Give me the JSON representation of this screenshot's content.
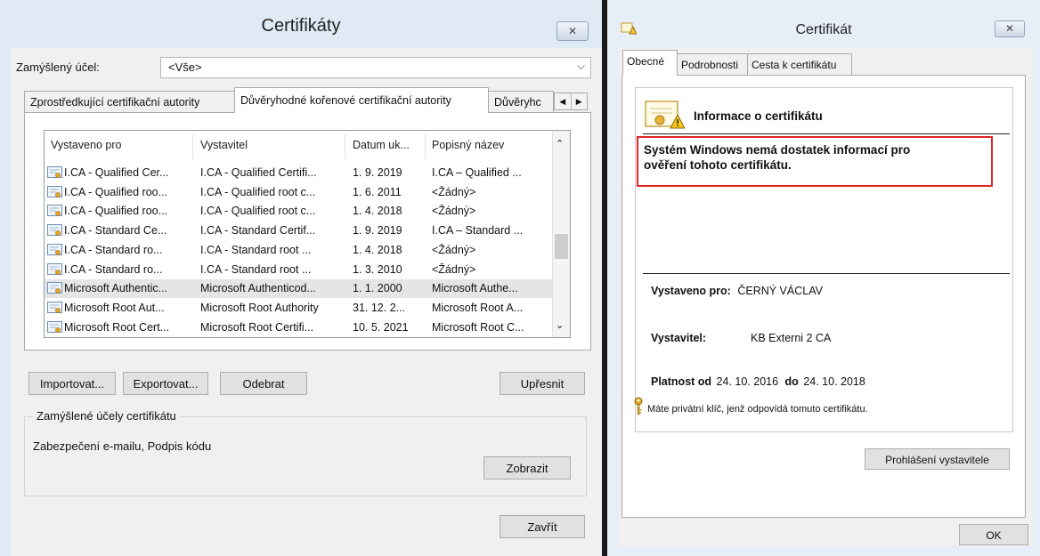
{
  "left_window": {
    "title": "Certifikáty",
    "close_glyph": "✕",
    "purpose_label": "Zamýšlený účel:",
    "purpose_value": "<Vše>",
    "tabs": [
      "Zprostředkující certifikační autority",
      "Důvěryhodné kořenové certifikační autority",
      "Důvěryhc"
    ],
    "columns": [
      "Vystaveno pro",
      "Vystavitel",
      "Datum uk...",
      "Popisný název"
    ],
    "rows": [
      {
        "issued_to": "I.CA - Qualified Cer...",
        "issuer": "I.CA - Qualified Certifi...",
        "date": "1. 9. 2019",
        "name": "I.CA – Qualified ..."
      },
      {
        "issued_to": "I.CA - Qualified roo...",
        "issuer": "I.CA - Qualified root c...",
        "date": "1. 6. 2011",
        "name": "<Žádný>"
      },
      {
        "issued_to": "I.CA - Qualified roo...",
        "issuer": "I.CA - Qualified root c...",
        "date": "1. 4. 2018",
        "name": "<Žádný>"
      },
      {
        "issued_to": "I.CA - Standard Ce...",
        "issuer": "I.CA - Standard Certif...",
        "date": "1. 9. 2019",
        "name": "I.CA – Standard ..."
      },
      {
        "issued_to": "I.CA - Standard ro...",
        "issuer": "I.CA - Standard root ...",
        "date": "1. 4. 2018",
        "name": "<Žádný>"
      },
      {
        "issued_to": "I.CA - Standard ro...",
        "issuer": "I.CA - Standard root ...",
        "date": "1. 3. 2010",
        "name": "<Žádný>"
      },
      {
        "issued_to": "Microsoft Authentic...",
        "issuer": "Microsoft Authenticod...",
        "date": "1. 1. 2000",
        "name": "Microsoft Authe..."
      },
      {
        "issued_to": "Microsoft Root Aut...",
        "issuer": "Microsoft Root Authority",
        "date": "31. 12. 2...",
        "name": "Microsoft Root A..."
      },
      {
        "issued_to": "Microsoft Root Cert...",
        "issuer": "Microsoft Root Certifi...",
        "date": "10. 5. 2021",
        "name": "Microsoft Root C..."
      }
    ],
    "buttons": {
      "import": "Importovat...",
      "export": "Exportovat...",
      "remove": "Odebrat",
      "advanced": "Upřesnit",
      "view": "Zobrazit",
      "close": "Zavřít"
    },
    "purposes_group_label": "Zamýšlené účely certifikátu",
    "purposes_value": "Zabezpečení e-mailu, Podpis kódu"
  },
  "right_window": {
    "title": "Certifikát",
    "close_glyph": "✕",
    "tabs": [
      "Obecné",
      "Podrobnosti",
      "Cesta k certifikátu"
    ],
    "info_title": "Informace o certifikátu",
    "warning_line1": "Systém Windows nemá dostatek informací pro",
    "warning_line2": "ověření tohoto certifikátu.",
    "issued_to_label": "Vystaveno pro:",
    "issued_to_value": "ČERNÝ VÁCLAV",
    "issuer_label": "Vystavitel:",
    "issuer_value": "KB Externi 2 CA",
    "valid_from_label": "Platnost od",
    "valid_from_value": "24. 10. 2016",
    "valid_to_label": "do",
    "valid_to_value": "24. 10. 2018",
    "private_key_note": "Máte privátní klíč, jenž odpovídá tomuto certifikátu.",
    "issuer_statement_button": "Prohlášení vystavitele",
    "ok_button": "OK"
  },
  "colors": {
    "highlight_border": "#e0252a",
    "window_frame": "#dfeaf5",
    "dialog_bg": "#f0f0f0"
  },
  "icons": [
    "certificate-icon",
    "certificate-warning-icon",
    "key-icon",
    "chevron-down-icon",
    "close-icon"
  ]
}
